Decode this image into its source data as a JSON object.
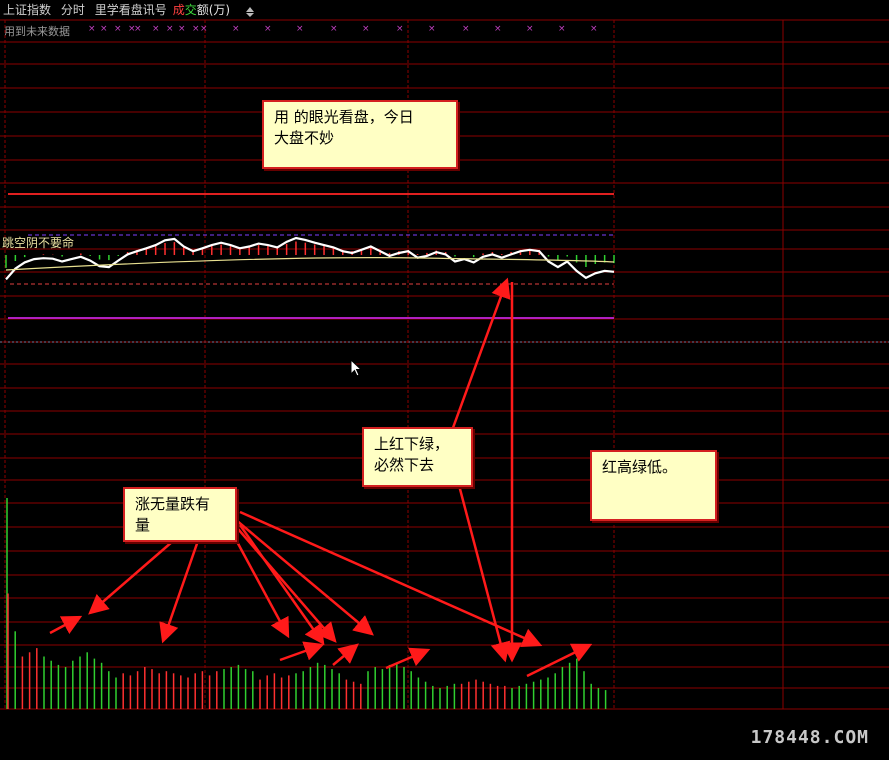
{
  "titlebar": {
    "index_name": "上证指数",
    "mode": "分时",
    "indicator": "里学看盘讯号",
    "vol_part1": "成",
    "vol_part2": "交",
    "vol_part3": "额(万)"
  },
  "future_label": "用到未来数据",
  "gap_label": "跳空阴不要命",
  "notes": {
    "top": "用 的眼光看盘，今日\n大盘不妙",
    "middle": "上红下绿，\n必然下去",
    "right": "红高绿低。",
    "left": "涨无量跌有\n量"
  },
  "watermark": "178448.COM",
  "colors": {
    "grid": "#8b0000",
    "up": "#ff3030",
    "down": "#30d030",
    "price": "#ffffff",
    "avg": "#e8e090",
    "purple": "#b020c0",
    "arrow": "#ff1a1a"
  },
  "chart_data": {
    "type": "bar",
    "volume_bars": [
      {
        "dir": "up",
        "v": 0.55
      },
      {
        "dir": "down",
        "v": 0.37
      },
      {
        "dir": "up",
        "v": 0.25
      },
      {
        "dir": "up",
        "v": 0.27
      },
      {
        "dir": "up",
        "v": 0.29
      },
      {
        "dir": "down",
        "v": 0.25
      },
      {
        "dir": "down",
        "v": 0.23
      },
      {
        "dir": "down",
        "v": 0.21
      },
      {
        "dir": "down",
        "v": 0.2
      },
      {
        "dir": "down",
        "v": 0.23
      },
      {
        "dir": "down",
        "v": 0.25
      },
      {
        "dir": "down",
        "v": 0.27
      },
      {
        "dir": "down",
        "v": 0.24
      },
      {
        "dir": "down",
        "v": 0.22
      },
      {
        "dir": "down",
        "v": 0.18
      },
      {
        "dir": "down",
        "v": 0.15
      },
      {
        "dir": "up",
        "v": 0.17
      },
      {
        "dir": "up",
        "v": 0.16
      },
      {
        "dir": "up",
        "v": 0.18
      },
      {
        "dir": "up",
        "v": 0.2
      },
      {
        "dir": "up",
        "v": 0.19
      },
      {
        "dir": "up",
        "v": 0.17
      },
      {
        "dir": "up",
        "v": 0.18
      },
      {
        "dir": "up",
        "v": 0.17
      },
      {
        "dir": "up",
        "v": 0.16
      },
      {
        "dir": "up",
        "v": 0.15
      },
      {
        "dir": "up",
        "v": 0.17
      },
      {
        "dir": "up",
        "v": 0.18
      },
      {
        "dir": "up",
        "v": 0.16
      },
      {
        "dir": "up",
        "v": 0.18
      },
      {
        "dir": "down",
        "v": 0.19
      },
      {
        "dir": "down",
        "v": 0.2
      },
      {
        "dir": "down",
        "v": 0.21
      },
      {
        "dir": "down",
        "v": 0.19
      },
      {
        "dir": "down",
        "v": 0.18
      },
      {
        "dir": "up",
        "v": 0.14
      },
      {
        "dir": "up",
        "v": 0.16
      },
      {
        "dir": "up",
        "v": 0.17
      },
      {
        "dir": "up",
        "v": 0.15
      },
      {
        "dir": "up",
        "v": 0.16
      },
      {
        "dir": "down",
        "v": 0.17
      },
      {
        "dir": "down",
        "v": 0.18
      },
      {
        "dir": "down",
        "v": 0.2
      },
      {
        "dir": "down",
        "v": 0.22
      },
      {
        "dir": "down",
        "v": 0.21
      },
      {
        "dir": "down",
        "v": 0.19
      },
      {
        "dir": "down",
        "v": 0.17
      },
      {
        "dir": "up",
        "v": 0.14
      },
      {
        "dir": "up",
        "v": 0.13
      },
      {
        "dir": "up",
        "v": 0.12
      },
      {
        "dir": "down",
        "v": 0.18
      },
      {
        "dir": "down",
        "v": 0.2
      },
      {
        "dir": "down",
        "v": 0.19
      },
      {
        "dir": "down",
        "v": 0.21
      },
      {
        "dir": "down",
        "v": 0.22
      },
      {
        "dir": "down",
        "v": 0.2
      },
      {
        "dir": "down",
        "v": 0.18
      },
      {
        "dir": "down",
        "v": 0.15
      },
      {
        "dir": "down",
        "v": 0.13
      },
      {
        "dir": "down",
        "v": 0.11
      },
      {
        "dir": "down",
        "v": 0.1
      },
      {
        "dir": "down",
        "v": 0.11
      },
      {
        "dir": "down",
        "v": 0.12
      },
      {
        "dir": "up",
        "v": 0.12
      },
      {
        "dir": "up",
        "v": 0.13
      },
      {
        "dir": "up",
        "v": 0.14
      },
      {
        "dir": "up",
        "v": 0.13
      },
      {
        "dir": "up",
        "v": 0.12
      },
      {
        "dir": "up",
        "v": 0.11
      },
      {
        "dir": "up",
        "v": 0.11
      },
      {
        "dir": "down",
        "v": 0.1
      },
      {
        "dir": "down",
        "v": 0.11
      },
      {
        "dir": "down",
        "v": 0.12
      },
      {
        "dir": "down",
        "v": 0.13
      },
      {
        "dir": "down",
        "v": 0.14
      },
      {
        "dir": "down",
        "v": 0.15
      },
      {
        "dir": "down",
        "v": 0.17
      },
      {
        "dir": "down",
        "v": 0.2
      },
      {
        "dir": "down",
        "v": 0.22
      },
      {
        "dir": "down",
        "v": 0.24
      },
      {
        "dir": "down",
        "v": 0.18
      },
      {
        "dir": "down",
        "v": 0.12
      },
      {
        "dir": "down",
        "v": 0.1
      },
      {
        "dir": "down",
        "v": 0.09
      }
    ],
    "price_line": [
      0.12,
      0.35,
      0.48,
      0.55,
      0.57,
      0.56,
      0.5,
      0.55,
      0.6,
      0.52,
      0.4,
      0.38,
      0.52,
      0.65,
      0.72,
      0.78,
      0.85,
      0.95,
      0.98,
      0.82,
      0.72,
      0.78,
      0.85,
      0.9,
      0.85,
      0.78,
      0.82,
      0.88,
      0.85,
      0.8,
      0.92,
      1.0,
      0.96,
      0.9,
      0.85,
      0.8,
      0.72,
      0.68,
      0.75,
      0.82,
      0.72,
      0.62,
      0.68,
      0.72,
      0.58,
      0.62,
      0.7,
      0.65,
      0.5,
      0.55,
      0.48,
      0.6,
      0.65,
      0.58,
      0.65,
      0.72,
      0.75,
      0.72,
      0.5,
      0.38,
      0.5,
      0.3,
      0.15,
      0.25,
      0.3,
      0.28
    ]
  }
}
